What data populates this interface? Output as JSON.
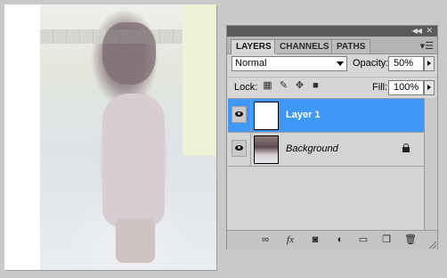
{
  "panel": {
    "tabs": [
      "LAYERS",
      "CHANNELS",
      "PATHS"
    ],
    "active_tab": "LAYERS",
    "blend_mode": "Normal",
    "opacity_label": "Opacity:",
    "opacity_value": "50%",
    "lock_label": "Lock:",
    "fill_label": "Fill:",
    "fill_value": "100%",
    "layers": [
      {
        "name": "Layer 1",
        "selected": true,
        "visible": true,
        "locked": false
      },
      {
        "name": "Background",
        "selected": false,
        "visible": true,
        "locked": true
      }
    ],
    "icons": {
      "collapse": "collapse-panel-icon",
      "close": "close-panel-icon",
      "menu": "panel-menu-icon",
      "lock_icons": [
        "lock-transparent-pixels-icon",
        "lock-image-pixels-icon",
        "lock-position-icon",
        "lock-all-icon"
      ],
      "bottom": [
        "link-layers-icon",
        "layer-style-icon",
        "layer-mask-icon",
        "adjustment-layer-icon",
        "new-group-icon",
        "new-layer-icon",
        "delete-layer-icon"
      ]
    },
    "colors": {
      "selection": "#3f98f5",
      "panel": "#d6d6d6"
    }
  }
}
